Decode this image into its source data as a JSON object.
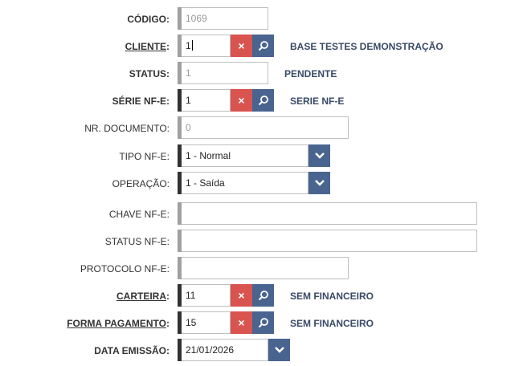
{
  "form": {
    "codigo": {
      "label": "CÓDIGO:",
      "value": "1069"
    },
    "cliente": {
      "label": "CLIENTE",
      "value": "1",
      "description": "BASE TESTES DEMONSTRAÇÃO"
    },
    "status": {
      "label": "STATUS:",
      "value": "1",
      "description": "PENDENTE"
    },
    "serie": {
      "label": "SÉRIE NF-E:",
      "value": "1",
      "description": "SERIE NF-E"
    },
    "nr_documento": {
      "label": "NR. DOCUMENTO:",
      "value": "0"
    },
    "tipo": {
      "label": "TIPO NF-E:",
      "value": "1 - Normal"
    },
    "operacao": {
      "label": "OPERAÇÃO:",
      "value": "1 - Saída"
    },
    "chave": {
      "label": "CHAVE NF-E:",
      "value": ""
    },
    "status_nfe": {
      "label": "STATUS NF-E:",
      "value": ""
    },
    "protocolo": {
      "label": "PROTOCOLO NF-E:",
      "value": ""
    },
    "carteira": {
      "label": "CARTEIRA",
      "value": "11",
      "description": "SEM FINANCEIRO"
    },
    "forma_pagamento": {
      "label": "FORMA PAGAMENTO",
      "value": "15",
      "description": "SEM FINANCEIRO"
    },
    "data_emissao": {
      "label": "DATA EMISSÃO:",
      "value": "21/01/2026"
    }
  },
  "colon": ":",
  "icons": {
    "clear": "×",
    "search": "search-icon",
    "dropdown": "chevron-down-icon"
  },
  "colors": {
    "required_bar": "#333333",
    "optional_bar": "#a0a0a0",
    "clear_button": "#d9534f",
    "action_button": "#4a6490"
  }
}
